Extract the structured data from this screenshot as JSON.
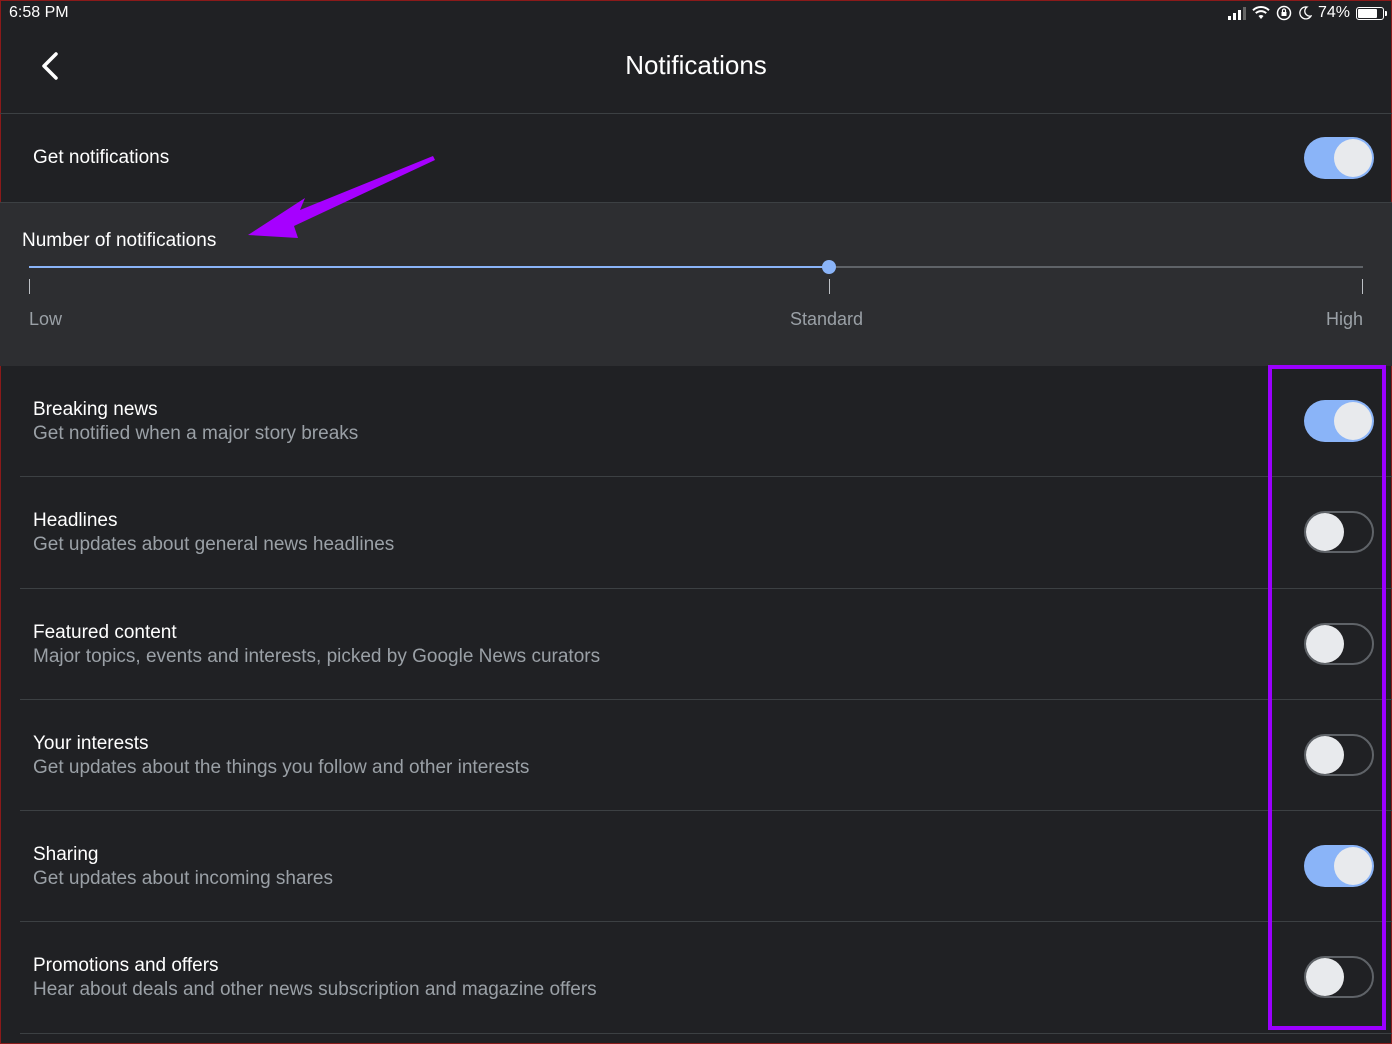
{
  "status_bar": {
    "time": "6:58 PM",
    "battery": "74%"
  },
  "header": {
    "title": "Notifications"
  },
  "master": {
    "label": "Get notifications",
    "enabled": true
  },
  "notification_level": {
    "label": "Number of notifications",
    "options": [
      "Low",
      "Standard",
      "High"
    ],
    "selected": "Standard",
    "selected_index": 1
  },
  "settings": [
    {
      "title": "Breaking news",
      "description": "Get notified when a major story breaks",
      "enabled": true
    },
    {
      "title": "Headlines",
      "description": "Get updates about general news headlines",
      "enabled": false
    },
    {
      "title": "Featured content",
      "description": "Major topics, events and interests, picked by Google News curators",
      "enabled": false
    },
    {
      "title": "Your interests",
      "description": "Get updates about the things you follow and other interests",
      "enabled": false
    },
    {
      "title": "Sharing",
      "description": "Get updates about incoming shares",
      "enabled": true
    },
    {
      "title": "Promotions and offers",
      "description": "Hear about deals and other news subscription and magazine offers",
      "enabled": false
    }
  ],
  "colors": {
    "background": "#202124",
    "accent": "#8ab4f8",
    "annotation": "#9b00ff"
  }
}
